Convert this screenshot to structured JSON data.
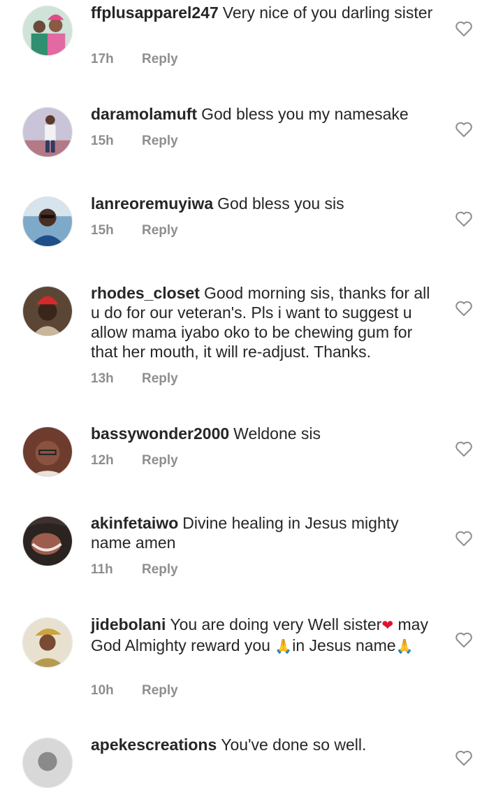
{
  "colors": {
    "text": "#262626",
    "meta": "#8e8e8e",
    "heart_outline": "#8e8e8e",
    "emoji_heart": "#e0142d",
    "emoji_pray": "#f7c33b"
  },
  "icons": {
    "like": "heart-outline-icon",
    "pray": "folded-hands-emoji",
    "red_heart": "red-heart-emoji"
  },
  "reply_label": "Reply",
  "comments": [
    {
      "username": "ffplusapparel247",
      "text": "Very nice of you darling sister",
      "time": "17h"
    },
    {
      "username": "daramolamuft",
      "text": "God bless you my namesake",
      "time": "15h"
    },
    {
      "username": "lanreoremuyiwa",
      "text": "God bless you sis",
      "time": "15h"
    },
    {
      "username": "rhodes_closet",
      "text": "Good morning sis, thanks for all u do for our veteran's. Pls i want to suggest u allow mama iyabo oko to be chewing gum for that her mouth, it will re-adjust. Thanks.",
      "time": "13h"
    },
    {
      "username": "bassywonder2000",
      "text": "Weldone sis",
      "time": "12h"
    },
    {
      "username": "akinfetaiwo",
      "text": "Divine healing in Jesus mighty name amen",
      "time": "11h"
    },
    {
      "username": "jidebolani",
      "text_parts": [
        "You are doing very Well sister",
        "may God Almighty reward you ",
        "in Jesus name"
      ],
      "time": "10h"
    },
    {
      "username": "apekescreations",
      "text": "You've done so well."
    }
  ]
}
